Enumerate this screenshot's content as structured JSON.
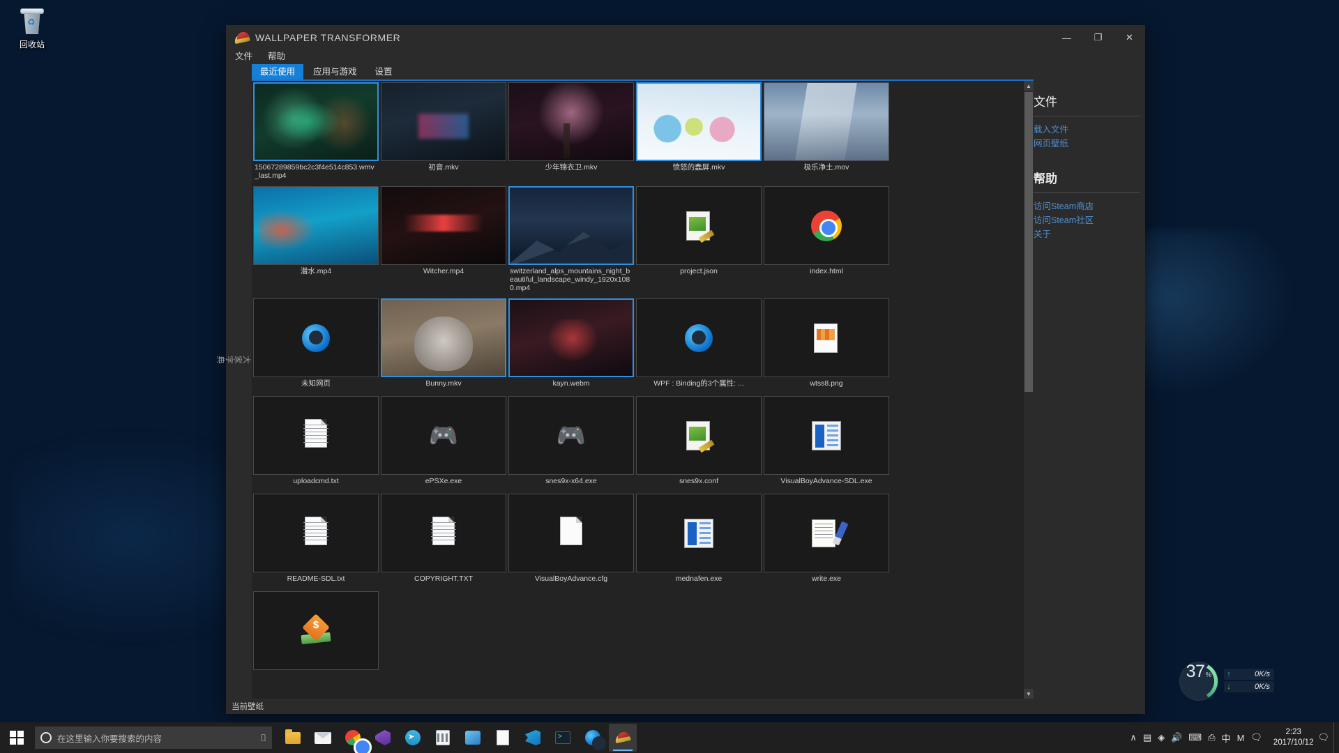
{
  "desktop": {
    "recycle_bin_label": "回收站",
    "net_widget": {
      "percent": "37",
      "percent_symbol": "%",
      "upload": "0K/s",
      "download": "0K/s",
      "up_arrow": "↑",
      "down_arrow": "↓"
    }
  },
  "window": {
    "title": "WALLPAPER TRANSFORMER",
    "icon_name": "wallpaper-transformer-icon",
    "controls": {
      "minimize": "—",
      "maximize": "❐",
      "close": "✕"
    },
    "menu": [
      {
        "label": "文件",
        "name": "menu-file"
      },
      {
        "label": "帮助",
        "name": "menu-help"
      }
    ],
    "vertical_tab": "大家字典",
    "tabs": [
      {
        "label": "最近使用",
        "active": true
      },
      {
        "label": "应用与游戏",
        "active": false
      },
      {
        "label": "设置",
        "active": false
      }
    ],
    "status_bar": "当前壁纸",
    "accent_color": "#1580d6"
  },
  "files": [
    {
      "caption": "15067289859bc2c3f4e514c853.wmv_last.mp4",
      "art": "art-dota",
      "icon": null,
      "selected": true,
      "align": "left"
    },
    {
      "caption": "初音.mkv",
      "art": "art-room",
      "icon": null,
      "selected": false,
      "align": "center"
    },
    {
      "caption": "少年锦衣卫.mkv",
      "art": "art-sakura",
      "icon": null,
      "selected": false,
      "align": "center"
    },
    {
      "caption": "愤怒的蠢屏.mkv",
      "art": "art-owls",
      "icon": null,
      "selected": true,
      "align": "center"
    },
    {
      "caption": "极乐净土.mov",
      "art": "art-sky",
      "icon": null,
      "selected": false,
      "align": "center"
    },
    {
      "caption": "潜水.mp4",
      "art": "art-dive",
      "icon": null,
      "selected": false,
      "align": "center"
    },
    {
      "caption": "Witcher.mp4",
      "art": "art-witcher",
      "icon": null,
      "selected": false,
      "align": "center"
    },
    {
      "caption": "switzerland_alps_mountains_night_beautiful_landscape_windy_1920x1080.mp4",
      "art": "art-alps",
      "icon": null,
      "selected": true,
      "align": "left"
    },
    {
      "caption": "project.json",
      "art": null,
      "icon": "json-file-icon",
      "selected": false,
      "align": "center"
    },
    {
      "caption": "index.html",
      "art": null,
      "icon": "chrome-icon",
      "selected": false,
      "align": "center"
    },
    {
      "caption": "未知网页",
      "art": null,
      "icon": "edge-icon",
      "selected": false,
      "align": "center"
    },
    {
      "caption": "Bunny.mkv",
      "art": "art-bunny",
      "icon": null,
      "selected": true,
      "align": "center"
    },
    {
      "caption": "kayn.webm",
      "art": "art-kayn",
      "icon": null,
      "selected": true,
      "align": "center"
    },
    {
      "caption": "WPF : Binding的3个属性: ...",
      "art": null,
      "icon": "edge-icon",
      "selected": false,
      "align": "center"
    },
    {
      "caption": "wtss8.png",
      "art": null,
      "icon": "image-file-icon",
      "selected": false,
      "align": "center"
    },
    {
      "caption": "uploadcmd.txt",
      "art": null,
      "icon": "text-file-icon",
      "selected": false,
      "align": "center"
    },
    {
      "caption": "ePSXe.exe",
      "art": null,
      "icon": "gamepad-icon",
      "selected": false,
      "align": "center"
    },
    {
      "caption": "snes9x-x64.exe",
      "art": null,
      "icon": "gamepad-icon",
      "selected": false,
      "align": "center"
    },
    {
      "caption": "snes9x.conf",
      "art": null,
      "icon": "json-file-icon",
      "selected": false,
      "align": "center"
    },
    {
      "caption": "VisualBoyAdvance-SDL.exe",
      "art": null,
      "icon": "vba-icon",
      "selected": false,
      "align": "center"
    },
    {
      "caption": "README-SDL.txt",
      "art": null,
      "icon": "text-file-icon",
      "selected": false,
      "align": "center"
    },
    {
      "caption": "COPYRIGHT.TXT",
      "art": null,
      "icon": "text-file-icon",
      "selected": false,
      "align": "center"
    },
    {
      "caption": "VisualBoyAdvance.cfg",
      "art": null,
      "icon": "blank-file-icon",
      "selected": false,
      "align": "center"
    },
    {
      "caption": "mednafen.exe",
      "art": null,
      "icon": "vba-icon",
      "selected": false,
      "align": "center"
    },
    {
      "caption": "write.exe",
      "art": null,
      "icon": "write-icon",
      "selected": false,
      "align": "center"
    },
    {
      "caption": "",
      "art": null,
      "icon": "money-icon",
      "selected": false,
      "align": "center"
    }
  ],
  "sidebar": {
    "sections": [
      {
        "heading": "文件",
        "links": [
          {
            "label": "载入文件",
            "name": "load-file-link"
          },
          {
            "label": "网页壁纸",
            "name": "web-wallpaper-link"
          }
        ]
      },
      {
        "heading": "帮助",
        "links": [
          {
            "label": "访问Steam商店",
            "name": "steam-store-link"
          },
          {
            "label": "访问Steam社区",
            "name": "steam-community-link"
          },
          {
            "label": "关于",
            "name": "about-link"
          }
        ]
      }
    ],
    "link_color": "#4f8fd0"
  },
  "taskbar": {
    "search_placeholder": "在这里输入你要搜索的内容",
    "clock_time": "2:23",
    "clock_date": "2017/10/12",
    "apps": [
      {
        "name": "file-explorer",
        "glyph": "g-folder",
        "active": false
      },
      {
        "name": "mail",
        "glyph": "g-mail",
        "active": false
      },
      {
        "name": "chrome",
        "glyph": "chrome",
        "active": false
      },
      {
        "name": "visual-studio",
        "glyph": "g-vs",
        "active": false
      },
      {
        "name": "telegram",
        "glyph": "g-tg",
        "active": false
      },
      {
        "name": "calculator",
        "glyph": "g-calc",
        "active": false
      },
      {
        "name": "paint",
        "glyph": "g-paint",
        "active": false
      },
      {
        "name": "notepad",
        "glyph": "g-doc",
        "active": false
      },
      {
        "name": "vs-code",
        "glyph": "g-vscode",
        "active": false
      },
      {
        "name": "terminal",
        "glyph": "g-term",
        "active": false
      },
      {
        "name": "edge",
        "glyph": "edge",
        "active": false
      },
      {
        "name": "wallpaper-transformer",
        "glyph": "g-wt",
        "active": true
      }
    ],
    "tray": [
      "∧",
      "▤",
      "◈",
      "🔊",
      "⌨",
      "⎙",
      "中",
      "M",
      "🗨"
    ]
  }
}
